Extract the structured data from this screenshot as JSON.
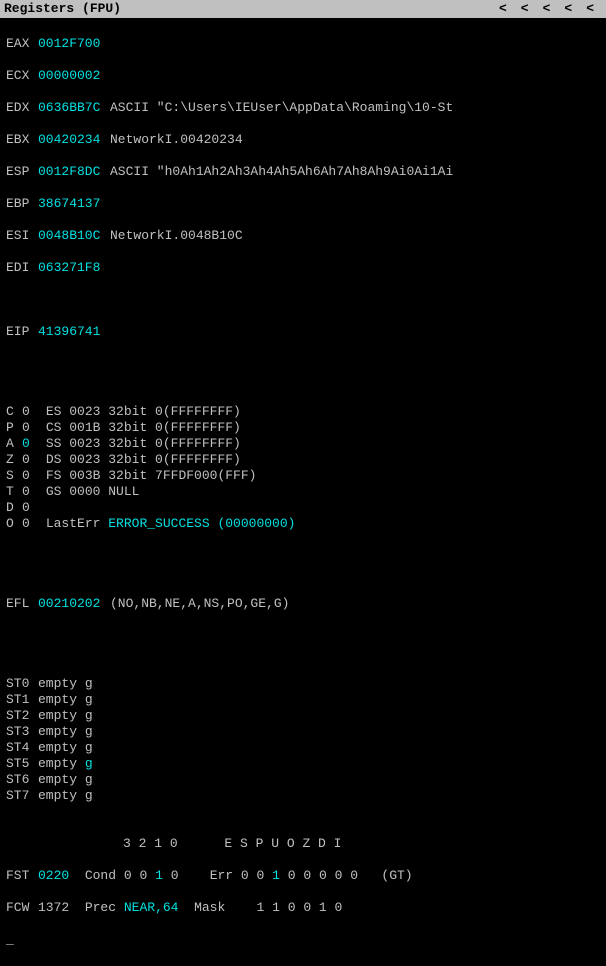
{
  "title": "Registers (FPU)",
  "arrows": [
    "<",
    "<",
    "<",
    "<",
    "<"
  ],
  "regs": {
    "EAX": {
      "v": "0012F700",
      "c": ""
    },
    "ECX": {
      "v": "00000002",
      "c": ""
    },
    "EDX": {
      "v": "0636BB7C",
      "c": "ASCII \"C:\\Users\\IEUser\\AppData\\Roaming\\10-St"
    },
    "EBX": {
      "v": "00420234",
      "c": "NetworkI.00420234"
    },
    "ESP": {
      "v": "0012F8DC",
      "c": "ASCII \"h0Ah1Ah2Ah3Ah4Ah5Ah6Ah7Ah8Ah9Ai0Ai1Ai"
    },
    "EBP": {
      "v": "38674137",
      "c": ""
    },
    "ESI": {
      "v": "0048B10C",
      "c": "NetworkI.0048B10C"
    },
    "EDI": {
      "v": "063271F8",
      "c": ""
    }
  },
  "eip": {
    "l": "EIP",
    "v": "41396741"
  },
  "flags": [
    {
      "f": "C",
      "b": "0",
      "s": "ES",
      "sv": "0023",
      "d": "32bit 0(FFFFFFFF)"
    },
    {
      "f": "P",
      "b": "0",
      "s": "CS",
      "sv": "001B",
      "d": "32bit 0(FFFFFFFF)"
    },
    {
      "f": "A",
      "b": "0",
      "s": "SS",
      "sv": "0023",
      "d": "32bit 0(FFFFFFFF)",
      "hi": true
    },
    {
      "f": "Z",
      "b": "0",
      "s": "DS",
      "sv": "0023",
      "d": "32bit 0(FFFFFFFF)"
    },
    {
      "f": "S",
      "b": "0",
      "s": "FS",
      "sv": "003B",
      "d": "32bit 7FFDF000(FFF)"
    },
    {
      "f": "T",
      "b": "0",
      "s": "GS",
      "sv": "0000",
      "d": "NULL"
    },
    {
      "f": "D",
      "b": "0",
      "s": "",
      "sv": "",
      "d": ""
    },
    {
      "f": "O",
      "b": "0",
      "s": "",
      "sv": "",
      "d": ""
    }
  ],
  "lasterr": {
    "l": "LastErr",
    "v": "ERROR_SUCCESS (00000000)"
  },
  "efl": {
    "l": "EFL",
    "v": "00210202",
    "c": "(NO,NB,NE,A,NS,PO,GE,G)"
  },
  "fpu": [
    {
      "n": "ST0",
      "s": "empty",
      "v": "g"
    },
    {
      "n": "ST1",
      "s": "empty",
      "v": "g"
    },
    {
      "n": "ST2",
      "s": "empty",
      "v": "g"
    },
    {
      "n": "ST3",
      "s": "empty",
      "v": "g"
    },
    {
      "n": "ST4",
      "s": "empty",
      "v": "g"
    },
    {
      "n": "ST5",
      "s": "empty",
      "v": "g",
      "hi": true
    },
    {
      "n": "ST6",
      "s": "empty",
      "v": "g"
    },
    {
      "n": "ST7",
      "s": "empty",
      "v": "g"
    }
  ],
  "fst": {
    "hdr1": "               3 2 1 0      E S P U O Z D I",
    "l": "FST",
    "v": "0220",
    "cond": "Cond",
    "cv": [
      "0",
      "0",
      "1",
      "0"
    ],
    "err": "Err",
    "ev": [
      "0",
      "0",
      "1",
      "0",
      "0",
      "0",
      "0",
      "0"
    ],
    "gt": "(GT)"
  },
  "fcw": {
    "l": "FCW",
    "v": "1372",
    "p": "Prec",
    "pv": "NEAR,64",
    "m": "Mask",
    "mv": "1 1 0 0 1 0"
  },
  "caret": "_"
}
